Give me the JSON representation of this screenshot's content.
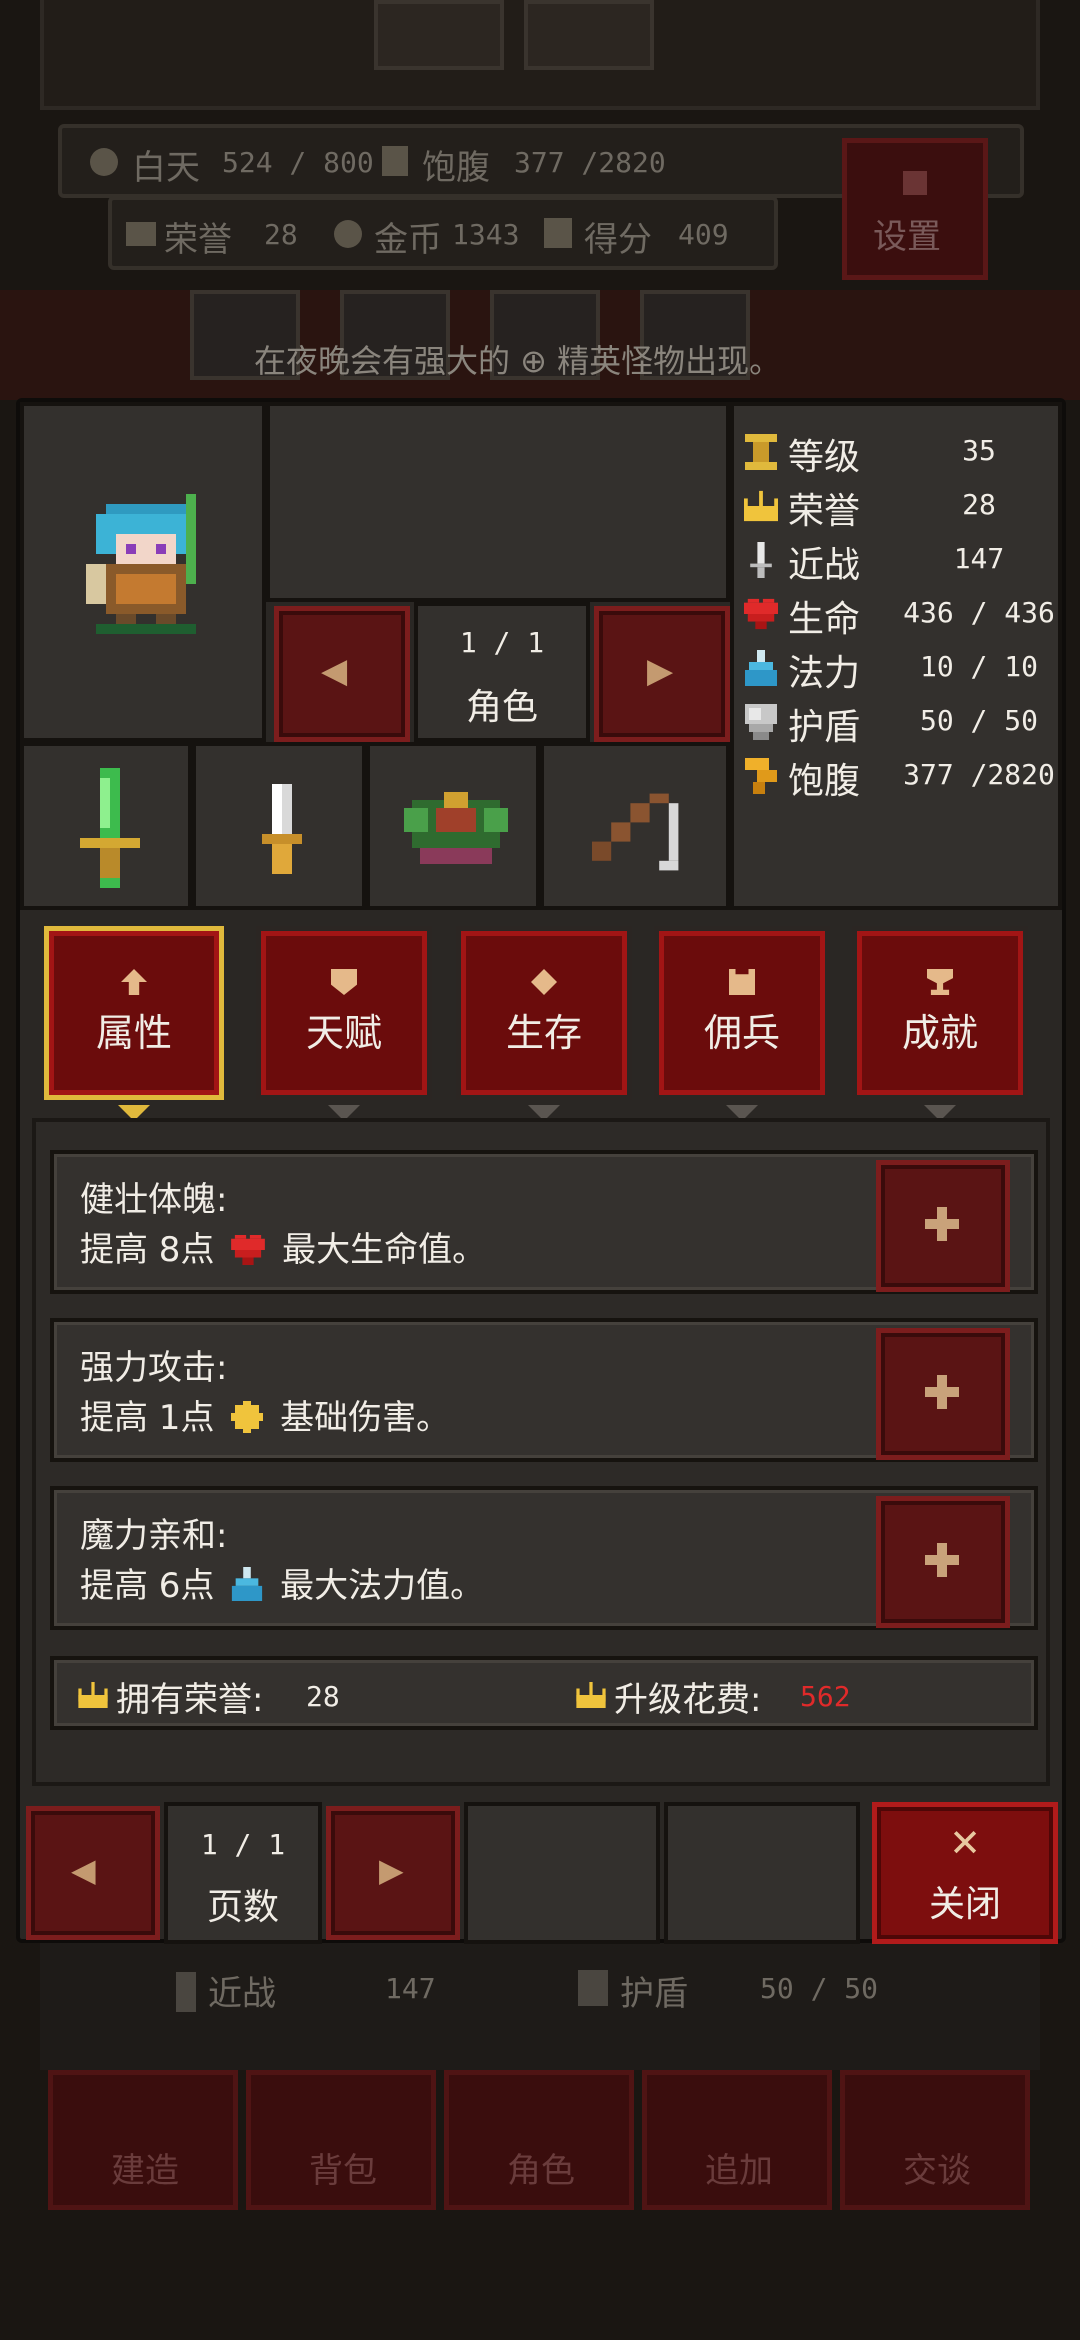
{
  "background": {
    "day_label": "白天",
    "day_value": "524 / 800",
    "hunger_label": "饱腹",
    "hunger_value": "377 /2820",
    "honor_label": "荣誉",
    "honor_value": "28",
    "gold_label": "金币",
    "gold_value": "1343",
    "score_label": "得分",
    "score_value": "409",
    "settings_label": "设置",
    "night_notice": "在夜晚会有强大的 ⊕ 精英怪物出现。",
    "peek_melee_label": "近战",
    "peek_melee_value": "147",
    "peek_shield_label": "护盾",
    "peek_shield_value": "50 / 50",
    "bottom_nav": [
      "建造",
      "背包",
      "角色",
      "追加",
      "交谈"
    ]
  },
  "character_panel": {
    "page_indicator": "1 / 1",
    "page_title": "角色",
    "prev_arrow": "◀",
    "next_arrow": "▶"
  },
  "stats": [
    {
      "label": "等级",
      "value": "35",
      "icon": "level-icon"
    },
    {
      "label": "荣誉",
      "value": "28",
      "icon": "crown-icon"
    },
    {
      "label": "近战",
      "value": "147",
      "icon": "sword-icon"
    },
    {
      "label": "生命",
      "value": "436 / 436",
      "icon": "heart-icon"
    },
    {
      "label": "法力",
      "value": "10 / 10",
      "icon": "potion-icon"
    },
    {
      "label": "护盾",
      "value": "50 / 50",
      "icon": "shield-icon"
    },
    {
      "label": "饱腹",
      "value": "377 /2820",
      "icon": "hunger-icon"
    }
  ],
  "tabs": [
    {
      "label": "属性",
      "icon": "up-arrow-icon",
      "active": true
    },
    {
      "label": "天赋",
      "icon": "shield-badge-icon",
      "active": false
    },
    {
      "label": "生存",
      "icon": "diamond-icon",
      "active": false
    },
    {
      "label": "佣兵",
      "icon": "bear-icon",
      "active": false
    },
    {
      "label": "成就",
      "icon": "trophy-icon",
      "active": false
    }
  ],
  "skills": [
    {
      "title": "健壮体魄:",
      "desc_prefix": "提高 8点",
      "desc_suffix": "最大生命值。",
      "icon": "heart-icon"
    },
    {
      "title": "强力攻击:",
      "desc_prefix": "提高 1点",
      "desc_suffix": "基础伤害。",
      "icon": "damage-icon"
    },
    {
      "title": "魔力亲和:",
      "desc_prefix": "提高 6点",
      "desc_suffix": "最大法力值。",
      "icon": "potion-icon"
    }
  ],
  "honor_bar": {
    "owned_label": "拥有荣誉:",
    "owned_value": "28",
    "cost_label": "升级花费:",
    "cost_value": "562",
    "cost_color": "#e02a2a"
  },
  "footer": {
    "page_indicator": "1 / 1",
    "page_label": "页数",
    "prev_arrow": "◀",
    "next_arrow": "▶",
    "close_label": "关闭",
    "close_icon": "✕"
  },
  "colors": {
    "active_tab_border": "#e0b93c",
    "button_red": "#7d0e0e",
    "panel": "#2a2724"
  }
}
